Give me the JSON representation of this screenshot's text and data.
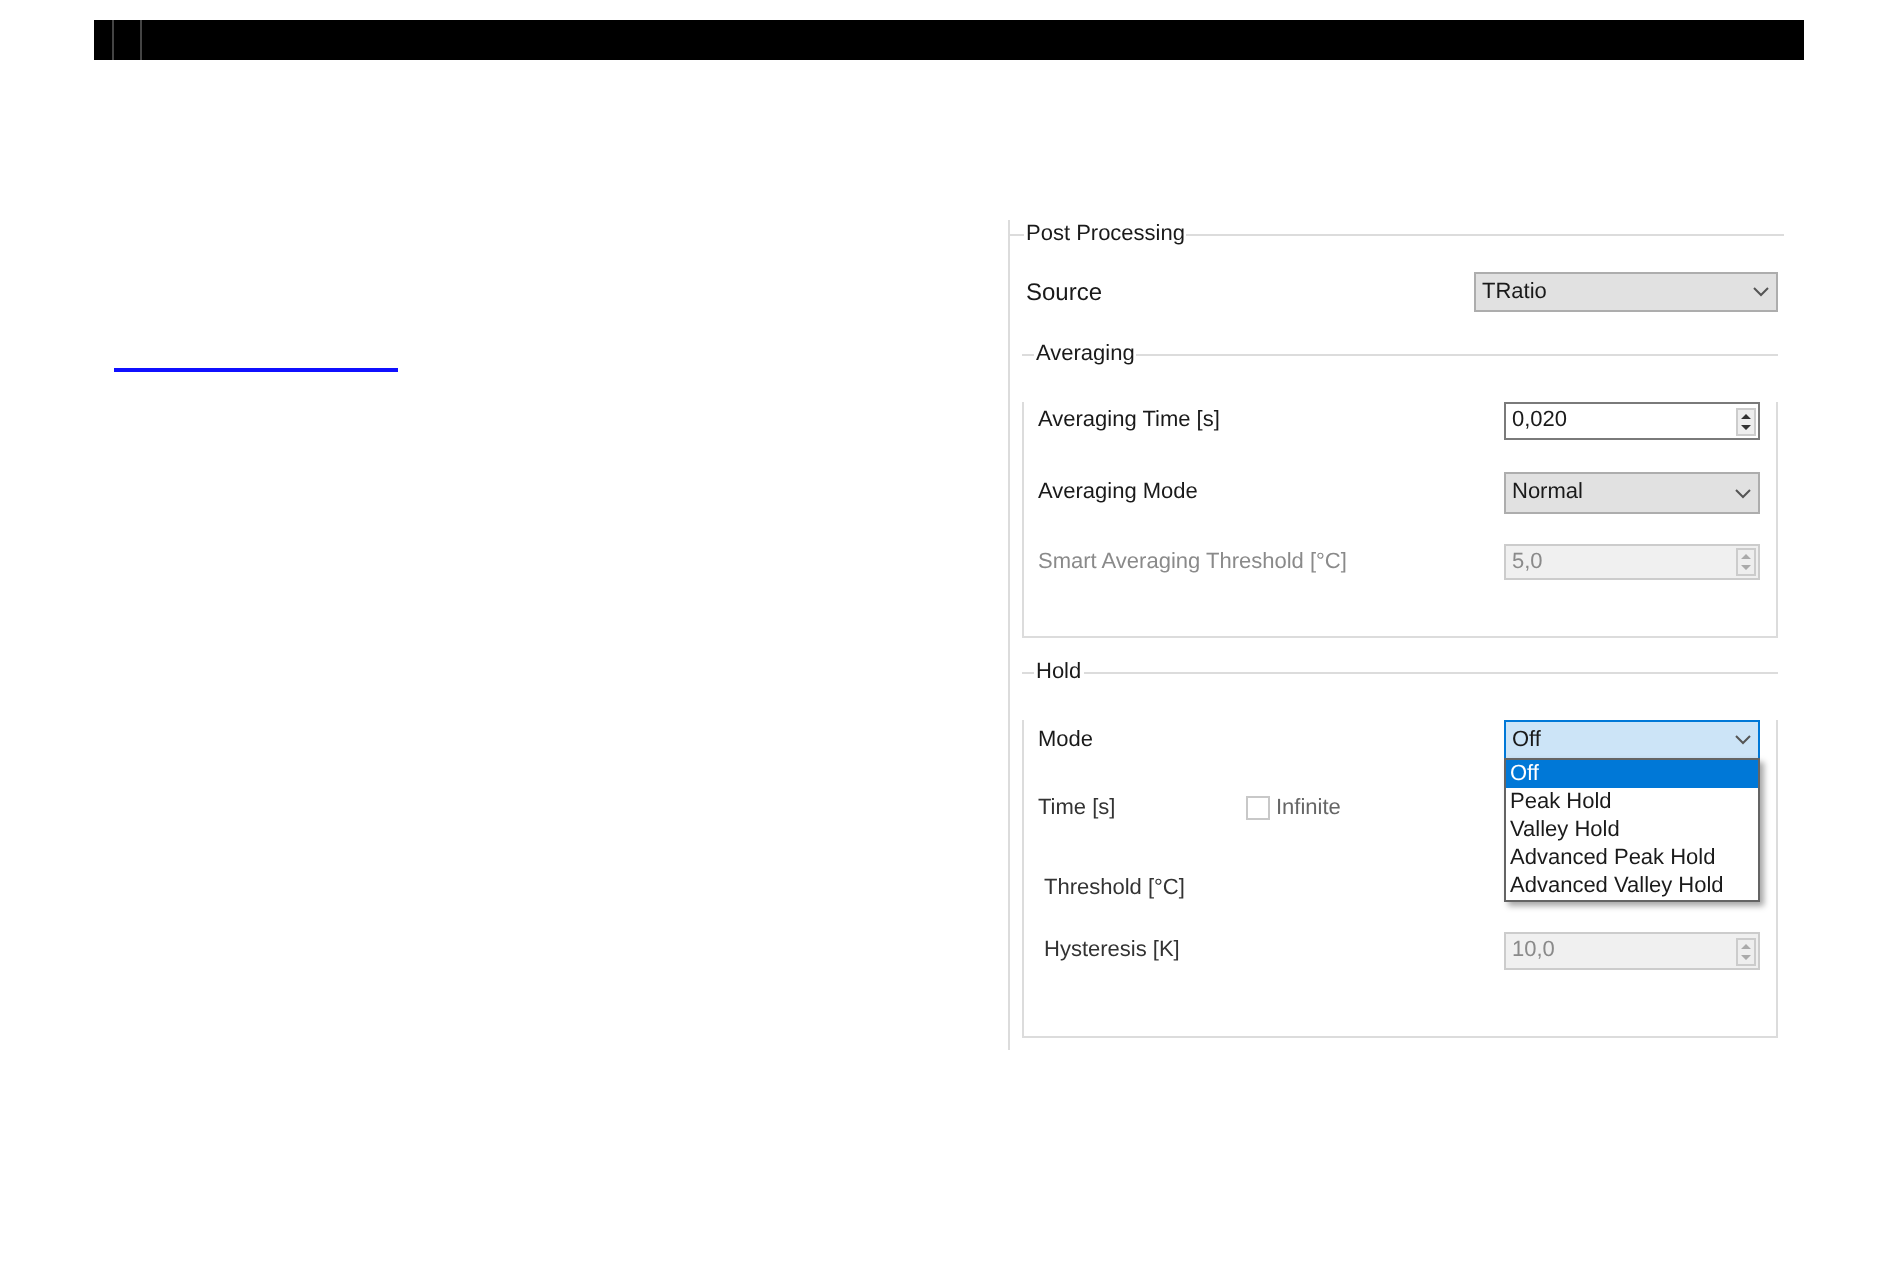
{
  "post_processing": {
    "title": "Post Processing",
    "source": {
      "label": "Source",
      "value": "TRatio"
    },
    "averaging": {
      "title": "Averaging",
      "rows": [
        {
          "kind": "spin",
          "label": "Averaging Time [s]",
          "value": "0,020",
          "disabled": false
        },
        {
          "kind": "combo",
          "label": "Averaging Mode",
          "value": "Normal",
          "disabled": false
        },
        {
          "kind": "spin",
          "label": "Smart Averaging Threshold [°C]",
          "value": "5,0",
          "disabled": true
        }
      ]
    },
    "hold": {
      "title": "Hold",
      "mode": {
        "label": "Mode",
        "value": "Off",
        "expanded": true,
        "options": [
          {
            "label": "Off",
            "selected": true
          },
          {
            "label": "Peak Hold",
            "selected": false
          },
          {
            "label": "Valley Hold",
            "selected": false
          },
          {
            "label": "Advanced Peak Hold",
            "selected": false
          },
          {
            "label": "Advanced Valley Hold",
            "selected": false
          }
        ]
      },
      "time": {
        "label": "Time [s]",
        "infinite": {
          "label": "Infinite",
          "checked": false
        }
      },
      "threshold": {
        "label": "Threshold [°C]"
      },
      "hysteresis": {
        "label": "Hysteresis [K]",
        "value": "10,0",
        "disabled": true
      }
    }
  }
}
